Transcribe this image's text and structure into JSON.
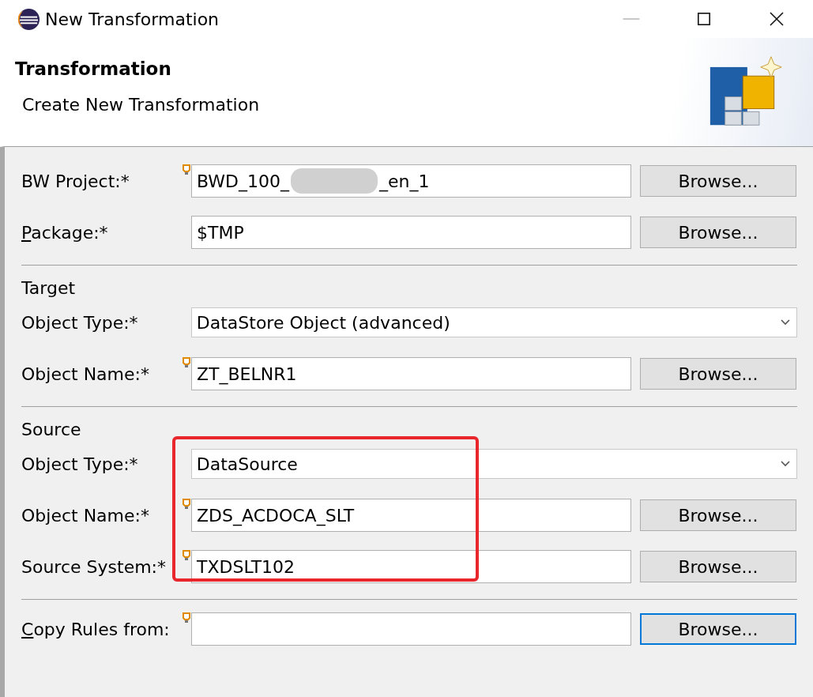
{
  "window": {
    "title": "New Transformation"
  },
  "header": {
    "title": "Transformation",
    "description": "Create New Transformation"
  },
  "sections": [
    {
      "rows": [
        {
          "kind": "text",
          "label": "BW Project:*",
          "underline_first": false,
          "hint": true,
          "value_start": "BWD_100_",
          "redacted": true,
          "value_end": "_en_1",
          "button": "Browse...",
          "focused": false
        },
        {
          "kind": "text",
          "label": "Package:*",
          "underline_first": true,
          "hint": false,
          "value_start": "$TMP",
          "redacted": false,
          "button": "Browse...",
          "focused": false
        }
      ]
    },
    {
      "title": "Target",
      "rows": [
        {
          "kind": "combo",
          "label": "Object Type:*",
          "underline_first": false,
          "value_start": "DataStore Object (advanced)"
        },
        {
          "kind": "text",
          "label": "Object Name:*",
          "underline_first": false,
          "hint": true,
          "value_start": "ZT_BELNR1",
          "redacted": false,
          "button": "Browse...",
          "focused": false
        }
      ]
    },
    {
      "title": "Source",
      "highlighted": true,
      "rows": [
        {
          "kind": "combo",
          "label": "Object Type:*",
          "underline_first": false,
          "value_start": "DataSource"
        },
        {
          "kind": "text",
          "label": "Object Name:*",
          "underline_first": false,
          "hint": true,
          "value_start": "ZDS_ACDOCA_SLT",
          "redacted": false,
          "button": "Browse...",
          "focused": false
        },
        {
          "kind": "text",
          "label": "Source System:*",
          "underline_first": false,
          "hint": true,
          "value_start": "TXDSLT102",
          "redacted": false,
          "button": "Browse...",
          "focused": false
        }
      ]
    },
    {
      "rows": [
        {
          "kind": "text",
          "label": "Copy Rules from:",
          "underline_first": true,
          "hint": true,
          "redacted": false,
          "button": "Browse...",
          "focused": true
        }
      ]
    }
  ]
}
